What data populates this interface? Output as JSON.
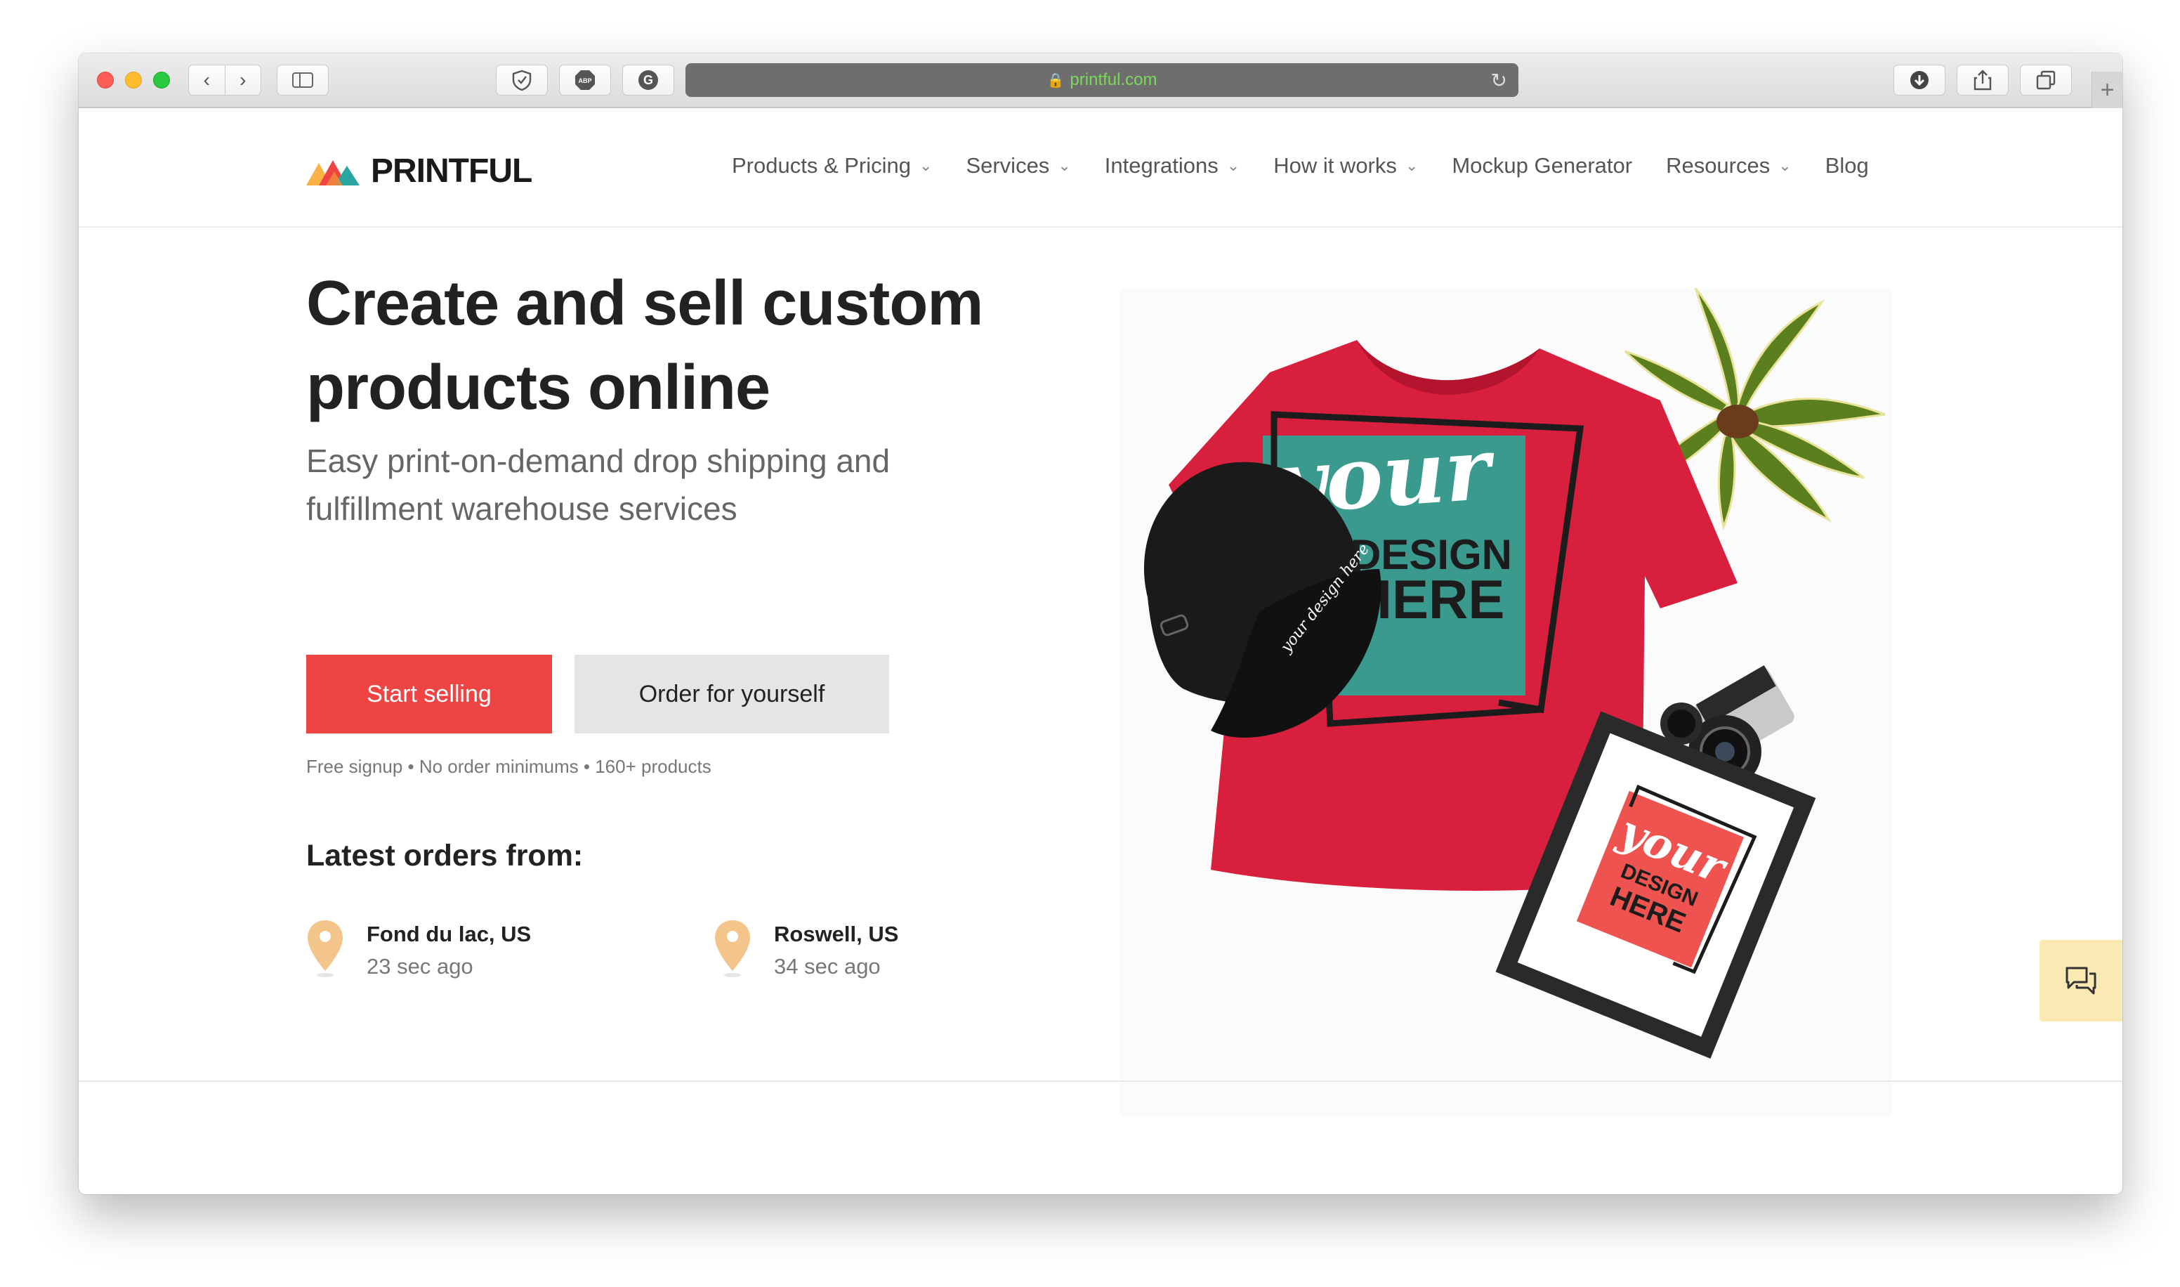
{
  "browser": {
    "url": "printful.com",
    "traffic_lights": [
      "close",
      "minimize",
      "zoom"
    ],
    "new_tab_label": "+"
  },
  "site": {
    "brand": "PRINTFUL",
    "nav": [
      {
        "label": "Products & Pricing",
        "has_dropdown": true
      },
      {
        "label": "Services",
        "has_dropdown": true
      },
      {
        "label": "Integrations",
        "has_dropdown": true
      },
      {
        "label": "How it works",
        "has_dropdown": true
      },
      {
        "label": "Mockup Generator",
        "has_dropdown": false
      },
      {
        "label": "Resources",
        "has_dropdown": true
      },
      {
        "label": "Blog",
        "has_dropdown": false
      }
    ]
  },
  "hero": {
    "title_line1": "Create and sell custom",
    "title_line2": "products online",
    "subtitle_line1": "Easy print-on-demand drop shipping and",
    "subtitle_line2": "fulfillment warehouse services",
    "primary_cta": "Start selling",
    "secondary_cta": "Order for yourself",
    "fineprint": "Free signup • No order minimums • 160+ products"
  },
  "latest_orders": {
    "title": "Latest orders from:",
    "orders": [
      {
        "city": "Fond du lac, US",
        "ago": "23 sec ago"
      },
      {
        "city": "Roswell, US",
        "ago": "34 sec ago"
      }
    ]
  },
  "product_image": {
    "shirt_text_line1": "your",
    "shirt_text_line2": "DESIGN",
    "shirt_text_line3": "HERE",
    "frame_text_line1": "your",
    "frame_text_line2": "DESIGN",
    "frame_text_line3": "HERE",
    "cap_text": "your design here"
  },
  "colors": {
    "accent": "#ef4444",
    "shirt": "#d8203e",
    "teal": "#3a9a8e",
    "pin": "#f4c58a",
    "chat_bg": "#fbe9b4"
  }
}
